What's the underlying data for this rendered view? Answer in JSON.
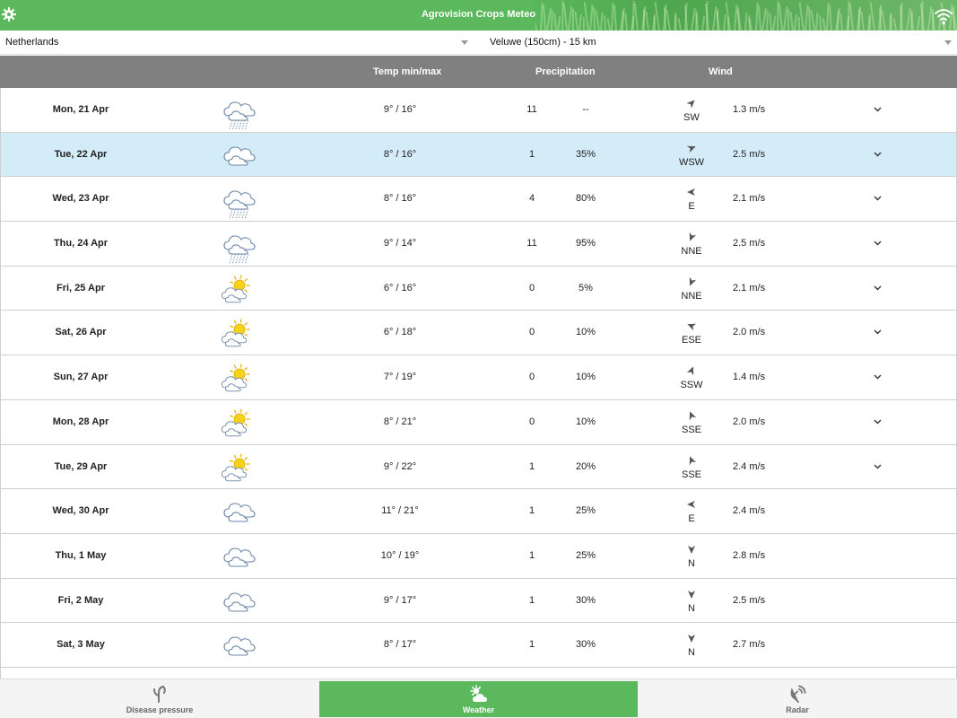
{
  "app": {
    "title": "Agrovision Crops Meteo"
  },
  "selectors": {
    "country": "Netherlands",
    "station": "Veluwe (150cm) - 15 km"
  },
  "columns": {
    "temp": "Temp min/max",
    "precip": "Precipitation",
    "wind": "Wind"
  },
  "forecast": [
    {
      "date": "Mon, 21 Apr",
      "icon": "cloud-rain-icon",
      "temp": "9° / 16°",
      "precip_mm": "11",
      "precip_pct": "--",
      "wind_dir": "SW",
      "wind_deg": 225,
      "wind_speed": "1.3 m/s",
      "expandable": true,
      "selected": false
    },
    {
      "date": "Tue, 22 Apr",
      "icon": "cloud-icon",
      "temp": "8° / 16°",
      "precip_mm": "1",
      "precip_pct": "35%",
      "wind_dir": "WSW",
      "wind_deg": 248,
      "wind_speed": "2.5 m/s",
      "expandable": true,
      "selected": true
    },
    {
      "date": "Wed, 23 Apr",
      "icon": "cloud-rain-icon",
      "temp": "8° / 16°",
      "precip_mm": "4",
      "precip_pct": "80%",
      "wind_dir": "E",
      "wind_deg": 90,
      "wind_speed": "2.1 m/s",
      "expandable": true,
      "selected": false
    },
    {
      "date": "Thu, 24 Apr",
      "icon": "cloud-rain-icon",
      "temp": "9° / 14°",
      "precip_mm": "11",
      "precip_pct": "95%",
      "wind_dir": "NNE",
      "wind_deg": 22,
      "wind_speed": "2.5 m/s",
      "expandable": true,
      "selected": false
    },
    {
      "date": "Fri, 25 Apr",
      "icon": "sun-cloud-icon",
      "temp": "6° / 16°",
      "precip_mm": "0",
      "precip_pct": "5%",
      "wind_dir": "NNE",
      "wind_deg": 22,
      "wind_speed": "2.1 m/s",
      "expandable": true,
      "selected": false
    },
    {
      "date": "Sat, 26 Apr",
      "icon": "sun-cloud-icon",
      "temp": "6° / 18°",
      "precip_mm": "0",
      "precip_pct": "10%",
      "wind_dir": "ESE",
      "wind_deg": 112,
      "wind_speed": "2.0 m/s",
      "expandable": true,
      "selected": false
    },
    {
      "date": "Sun, 27 Apr",
      "icon": "sun-cloud-icon",
      "temp": "7° / 19°",
      "precip_mm": "0",
      "precip_pct": "10%",
      "wind_dir": "SSW",
      "wind_deg": 202,
      "wind_speed": "1.4 m/s",
      "expandable": true,
      "selected": false
    },
    {
      "date": "Mon, 28 Apr",
      "icon": "sun-cloud-icon",
      "temp": "8° / 21°",
      "precip_mm": "0",
      "precip_pct": "10%",
      "wind_dir": "SSE",
      "wind_deg": 158,
      "wind_speed": "2.0 m/s",
      "expandable": true,
      "selected": false
    },
    {
      "date": "Tue, 29 Apr",
      "icon": "sun-cloud-icon",
      "temp": "9° / 22°",
      "precip_mm": "1",
      "precip_pct": "20%",
      "wind_dir": "SSE",
      "wind_deg": 158,
      "wind_speed": "2.4 m/s",
      "expandable": true,
      "selected": false
    },
    {
      "date": "Wed, 30 Apr",
      "icon": "cloud-icon",
      "temp": "11° / 21°",
      "precip_mm": "1",
      "precip_pct": "25%",
      "wind_dir": "E",
      "wind_deg": 90,
      "wind_speed": "2.4 m/s",
      "expandable": false,
      "selected": false
    },
    {
      "date": "Thu, 1 May",
      "icon": "cloud-icon",
      "temp": "10° / 19°",
      "precip_mm": "1",
      "precip_pct": "25%",
      "wind_dir": "N",
      "wind_deg": 0,
      "wind_speed": "2.8 m/s",
      "expandable": false,
      "selected": false
    },
    {
      "date": "Fri, 2 May",
      "icon": "cloud-icon",
      "temp": "9° / 17°",
      "precip_mm": "1",
      "precip_pct": "30%",
      "wind_dir": "N",
      "wind_deg": 0,
      "wind_speed": "2.5 m/s",
      "expandable": false,
      "selected": false
    },
    {
      "date": "Sat, 3 May",
      "icon": "cloud-icon",
      "temp": "8° / 17°",
      "precip_mm": "1",
      "precip_pct": "30%",
      "wind_dir": "N",
      "wind_deg": 0,
      "wind_speed": "2.7 m/s",
      "expandable": false,
      "selected": false
    }
  ],
  "nav": {
    "disease": "Disease pressure",
    "weather": "Weather",
    "radar": "Radar"
  },
  "colors": {
    "accent": "#5cb85c",
    "header_bar": "#808080",
    "selected_row": "#d4ebf8"
  }
}
